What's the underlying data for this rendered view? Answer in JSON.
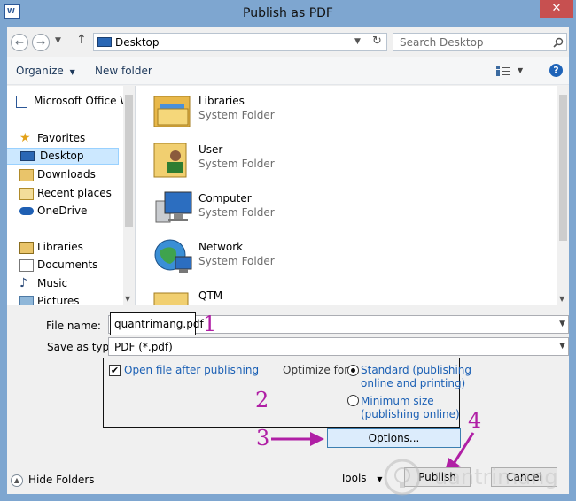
{
  "window": {
    "title": "Publish as PDF",
    "close_glyph": "✕",
    "app_icon": "word-document-icon"
  },
  "address": {
    "path": "Desktop",
    "search_placeholder": "Search Desktop"
  },
  "toolbar": {
    "organize_label": "Organize",
    "new_folder_label": "New folder"
  },
  "sidebar": {
    "items": [
      {
        "label": "Microsoft Office W",
        "icon": "word-document-icon"
      },
      {
        "label": "Favorites",
        "icon": "star-icon"
      },
      {
        "label": "Desktop",
        "icon": "desktop-icon",
        "selected": true
      },
      {
        "label": "Downloads",
        "icon": "downloads-icon"
      },
      {
        "label": "Recent places",
        "icon": "recent-places-icon"
      },
      {
        "label": "OneDrive",
        "icon": "cloud-icon"
      },
      {
        "label": "Libraries",
        "icon": "libraries-icon"
      },
      {
        "label": "Documents",
        "icon": "documents-icon"
      },
      {
        "label": "Music",
        "icon": "music-icon"
      },
      {
        "label": "Pictures",
        "icon": "pictures-icon"
      }
    ]
  },
  "files": [
    {
      "name": "Libraries",
      "type": "System Folder",
      "icon": "libraries-folder-icon"
    },
    {
      "name": "User",
      "type": "System Folder",
      "icon": "user-folder-icon"
    },
    {
      "name": "Computer",
      "type": "System Folder",
      "icon": "computer-icon"
    },
    {
      "name": "Network",
      "type": "System Folder",
      "icon": "network-globe-icon"
    },
    {
      "name": "QTM",
      "type": "",
      "icon": "folder-icon"
    }
  ],
  "form": {
    "file_name_label": "File name:",
    "file_name_value": "quantrimang.pdf",
    "save_type_label": "Save as type:",
    "save_type_value": "PDF (*.pdf)",
    "open_after_label": "Open file after publishing",
    "open_after_checked": true,
    "optimize_label": "Optimize for:",
    "standard_line1": "Standard (publishing",
    "standard_line2": "online and printing)",
    "minimum_line1": "Minimum size",
    "minimum_line2": "(publishing online)",
    "optimize_selected": "standard"
  },
  "buttons": {
    "options_label": "Options...",
    "tools_label": "Tools",
    "publish_label": "Publish",
    "cancel_label": "Cancel",
    "hide_folders_label": "Hide Folders"
  },
  "annotations": {
    "step1": "1",
    "step2": "2",
    "step3": "3",
    "step4": "4",
    "color": "#b01fa5"
  },
  "watermark": {
    "text": "uantrimang"
  }
}
